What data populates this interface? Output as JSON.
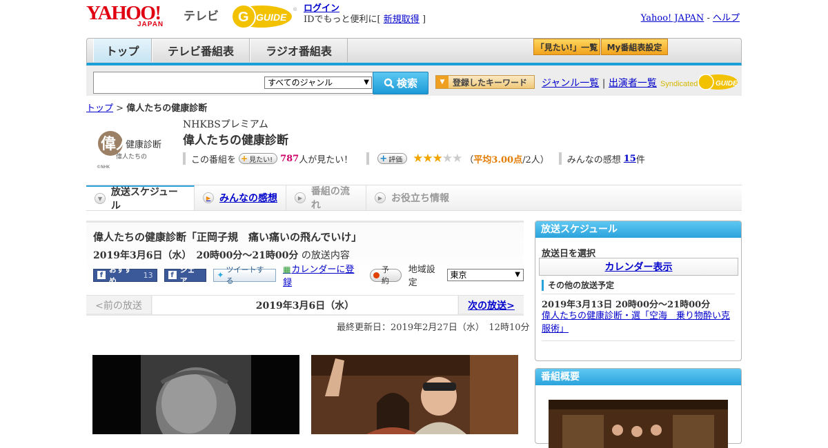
{
  "header": {
    "brand": {
      "yahoo": "YAHOO!",
      "japan": "JAPAN",
      "tv": "テレビ",
      "gguide": "GUIDE"
    },
    "login": "ログイン",
    "signup_prefix": "IDでもっと便利に[",
    "signup": "新規取得",
    "signup_suffix": "]",
    "yahoo_japan": "Yahoo! JAPAN",
    "separator": "-",
    "help": "ヘルプ"
  },
  "nav": {
    "tabs": [
      "トップ",
      "テレビ番組表",
      "ラジオ番組表"
    ],
    "mitai_list": "「見たい!」一覧",
    "my_schedule": "My番組表設定"
  },
  "search": {
    "input_value": "",
    "genre_selected": "すべてのジャンル",
    "button": "検索",
    "registered_keywords": "登録したキーワード",
    "genre_list": "ジャンル一覧",
    "divider": "|",
    "performer_list": "出演者一覧",
    "syndicated": "Syndicated",
    "syndicated_logo": "GUIDE"
  },
  "breadcrumb": {
    "top": "トップ",
    "sep": ">",
    "current": "偉人たちの健康診断"
  },
  "program": {
    "logo_text": "健康診断",
    "logo_sub": "偉人たちの",
    "logo_big": "偉人",
    "logo_credit": "©NHK",
    "channel": "NHKBSプレミアム",
    "title": "偉人たちの健康診断",
    "mitai_prefix": "この番組を",
    "mitai_button": "見たい!",
    "mitai_count": "787",
    "mitai_suffix": "人が見たい！",
    "rating_button": "評価",
    "rating_value": 3,
    "rating_max": 5,
    "rating_open": "（",
    "rating_avg": "平均3.00点",
    "rating_people": "/2人）",
    "impressions_prefix": "みんなの感想",
    "impressions_count": "15",
    "impressions_suffix": "件"
  },
  "content_tabs": [
    "放送スケジュール",
    "みんなの感想",
    "番組の流れ",
    "お役立ち情報"
  ],
  "episode": {
    "title": "偉人たちの健康診断「正岡子規　痛い痛いの飛んでいけ」",
    "datetime": "2019年3月6日（水）　20時00分～21時00分",
    "datetime_suffix": "の放送内容",
    "fb_recommend": "おすすめ",
    "fb_count": "13",
    "fb_share": "シェア",
    "tweet": "ツイートする",
    "calendar": "カレンダーに登録",
    "reserve": "予約",
    "region_label": "地域設定",
    "region_value": "東京"
  },
  "datebar": {
    "prev": "<前の放送",
    "current": "2019年3月6日（水）",
    "next": "次の放送>"
  },
  "updated": "最終更新日：2019年2月27日（水）　12時10分",
  "sidebar": {
    "schedule_head": "放送スケジュール",
    "pick_date": "放送日を選択",
    "calendar_button": "カレンダー表示",
    "other_label": "その他の放送予定",
    "other_date": "2019年3月13日  20時00分～21時00分",
    "other_title": "偉人たちの健康診断・選「空海　乗り物酔い克服術」",
    "summary_head": "番組概要"
  }
}
